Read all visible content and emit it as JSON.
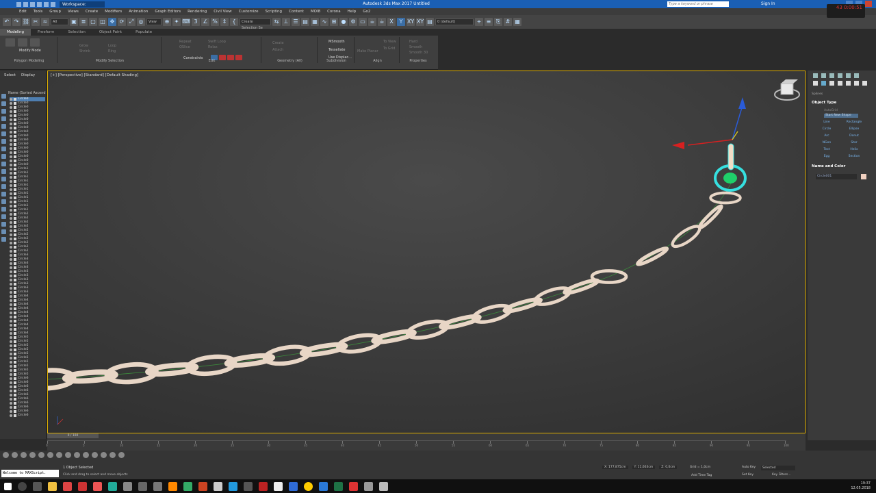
{
  "window": {
    "workspace": "Workspace: Default",
    "title": "Autodesk 3ds Max 2017    Untitled",
    "search_placeholder": "Type a keyword or phrase",
    "sign_in": "Sign In"
  },
  "menu": [
    "Edit",
    "Tools",
    "Group",
    "Views",
    "Create",
    "Modifiers",
    "Animation",
    "Graph Editors",
    "Rendering",
    "Civil View",
    "Customize",
    "Scripting",
    "Content",
    "MOI8",
    "Corona",
    "Help",
    "Go2"
  ],
  "toolbar": {
    "filter": "All",
    "view": "View",
    "selection_set": "Create Selection Se",
    "layer": "0 (default)",
    "axes": [
      "X",
      "Y",
      "XY",
      "XY"
    ]
  },
  "ribbon": {
    "tabs": [
      "Modeling",
      "Freeform",
      "Selection",
      "Object Paint",
      "Populate"
    ],
    "groups": {
      "polygon_modeling": "Polygon Modeling",
      "modify_selection": "Modify Selection",
      "edit": "Edit",
      "geometry": "Geometry (All)",
      "subdivision": "Subdivision",
      "align": "Align",
      "properties": "Properties"
    },
    "modify_mode": "Modify Mode",
    "items": [
      "Grow",
      "Shrink",
      "Loop",
      "Ring",
      "Repeat",
      "QSlice",
      "Swift Loop",
      "Relax",
      "Create",
      "Attach",
      "Constraints",
      "MSmooth",
      "Tessellate",
      "Use Displac...",
      "Make Planar",
      "To View",
      "To Grid",
      "Hard",
      "Smooth",
      "Smooth 30"
    ]
  },
  "scene_explorer": {
    "tabs": [
      "Select",
      "Display"
    ],
    "column": "Name (Sorted Ascend",
    "rows": [
      "Circle0",
      "Circle0",
      "Circle0",
      "Circle0",
      "Circle0",
      "Circle0",
      "Circle0",
      "Circle0",
      "Circle0",
      "Circle0",
      "Circle0",
      "Circle0",
      "Circle0",
      "Circle0",
      "Circle0",
      "Circle0",
      "Circle0",
      "Circle1",
      "Circle1",
      "Circle1",
      "Circle1",
      "Circle1",
      "Circle1",
      "Circle1",
      "Circle1",
      "Circle1",
      "Circle1",
      "Circle1",
      "Circle2",
      "Circle2",
      "Circle2",
      "Circle2",
      "Circle2",
      "Circle2",
      "Circle2",
      "Circle2",
      "Circle2",
      "Circle2",
      "Circle3",
      "Circle3",
      "Circle3",
      "Circle3",
      "Circle3",
      "Circle3",
      "Circle3",
      "Circle3",
      "Circle3",
      "Circle3",
      "Circle4",
      "Circle4",
      "Circle4",
      "Circle4",
      "Circle4",
      "Circle4",
      "Circle4",
      "Circle4",
      "Circle4",
      "Circle4",
      "Circle5",
      "Circle5",
      "Circle5",
      "Circle5",
      "Circle5",
      "Circle5",
      "Circle5",
      "Circle5",
      "Circle5",
      "Circle5",
      "Circle6",
      "Circle6",
      "Circle6",
      "Circle6",
      "Circle6",
      "Circle6",
      "Circle6",
      "Circle6",
      "Circle6",
      "Circle6"
    ]
  },
  "viewport": {
    "label": "[+] [Perspective] [Standard] [Default Shading]"
  },
  "command_panel": {
    "category": "Splines",
    "object_type": "Object Type",
    "autogrid": "AutoGrid",
    "start_new_shape": "Start New Shape",
    "buttons": [
      "Line",
      "Rectangle",
      "Circle",
      "Ellipse",
      "Arc",
      "Donut",
      "NGon",
      "Star",
      "Text",
      "Helix",
      "Egg",
      "Section"
    ],
    "name_and_color": "Name and Color",
    "name": "Circle001"
  },
  "timeline": {
    "frame": "0 / 100",
    "ticks": [
      "0",
      "5",
      "10",
      "15",
      "20",
      "25",
      "30",
      "35",
      "40",
      "45",
      "50",
      "55",
      "60",
      "65",
      "70",
      "75",
      "80",
      "85",
      "90",
      "95",
      "100"
    ]
  },
  "status": {
    "maxscript": "Welcome to MAXScript.",
    "selected": "1 Object Selected",
    "hint": "Click and drag to select and move objects",
    "x": "X: 177,875cm",
    "y": "Y: 11,663cm",
    "z": "Z: 0,0cm",
    "grid": "Grid = 1,0cm",
    "add_time_tag": "Add Time Tag",
    "auto_key": "Auto Key",
    "set_key": "Set Key",
    "selected_mode": "Selected",
    "key_filters": "Key Filters..."
  },
  "taskbar": {
    "time": "19:37",
    "date": "12.05.2018"
  },
  "clock_overlay": "43  0:00:51"
}
